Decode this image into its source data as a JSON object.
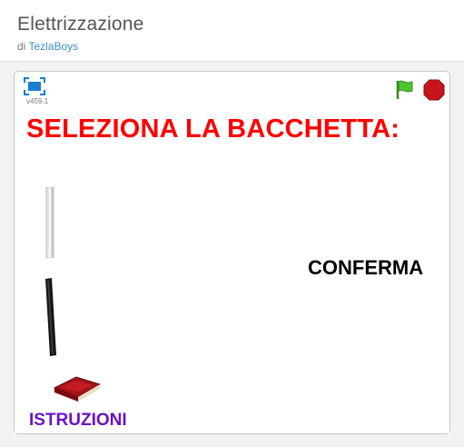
{
  "project": {
    "title": "Elettrizzazione",
    "by_prefix": "di",
    "author": "TezlaBoys"
  },
  "player": {
    "version": "v459.1",
    "icons": {
      "fullscreen": "fullscreen-icon",
      "flag": "green-flag-icon",
      "stop": "stop-icon"
    },
    "colors": {
      "accent": "#3b8ec9",
      "flag": "#4cc531",
      "stop": "#c9141c"
    }
  },
  "stage": {
    "heading": "SELEZIONA LA BACCHETTA:",
    "confirm_label": "CONFERMA",
    "instructions_label": "ISTRUZIONI",
    "colors": {
      "heading": "#ff0000",
      "instructions": "#6a12c6"
    }
  }
}
